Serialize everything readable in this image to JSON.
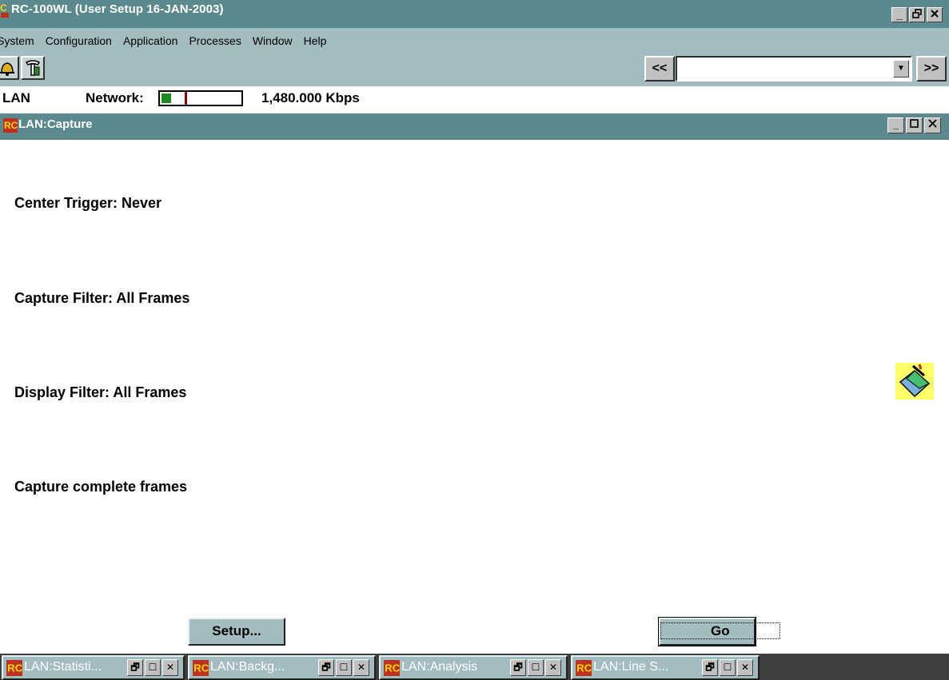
{
  "app": {
    "title": "RC-100WL (User Setup 16-JAN-2003)",
    "window_buttons": {
      "minimize": "_",
      "restore": "🗗",
      "close": "✕"
    }
  },
  "menu": {
    "items": [
      "System",
      "Configuration",
      "Application",
      "Processes",
      "Window",
      "Help"
    ]
  },
  "toolbar": {
    "icons": [
      "bell-icon",
      "tools-icon"
    ],
    "prev_label": "<<",
    "next_label": ">>",
    "combo_value": ""
  },
  "status": {
    "interface": "LAN",
    "network_label": "Network:",
    "network_utilization": 0.12,
    "rate": "1,480.000 Kbps"
  },
  "child_window": {
    "title": "LAN:Capture"
  },
  "capture": {
    "center_trigger": "Center Trigger: Never",
    "capture_filter": "Capture Filter: All Frames",
    "display_filter": "Display Filter: All Frames",
    "frames_mode": "Capture complete frames",
    "setup_label": "Setup...",
    "go_label": "Go"
  },
  "taskbar": {
    "tasks": [
      {
        "label": "LAN:Statisti..."
      },
      {
        "label": "LAN:Backg..."
      },
      {
        "label": "LAN:Analysis"
      },
      {
        "label": "LAN:Line S..."
      }
    ]
  },
  "colors": {
    "titlebar": "#5b8a8e",
    "menubar": "#a3bcbf",
    "taskbar": "#3e3e3e",
    "network_fill": "#1f8a1f"
  }
}
